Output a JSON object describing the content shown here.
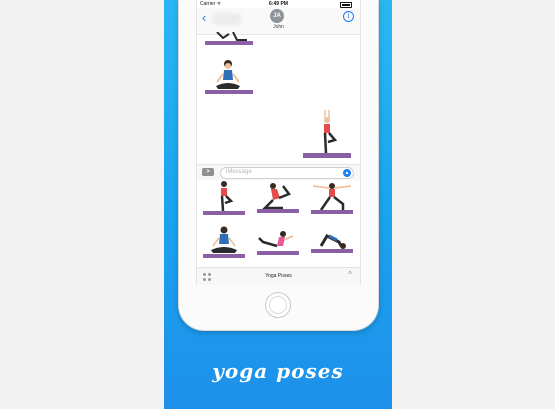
{
  "status_bar": {
    "carrier": "Carrier ᯤ",
    "time": "6:49 PM"
  },
  "nav": {
    "back": "‹",
    "avatar_initials": "JA",
    "contact_name": "John",
    "info_symbol": "i"
  },
  "compose": {
    "app_button": ">",
    "placeholder": "iMessage",
    "mic_symbol": "▲"
  },
  "tray": {
    "title": "Yoga Poses",
    "expand_symbol": "^"
  },
  "caption": "yoga poses",
  "colors": {
    "panel": "#1aa2ee",
    "mat": "#8a5fa6",
    "ios_blue": "#1d7df2",
    "skin": "#f0c09c",
    "hair": "#3b2a20"
  },
  "stickers": {
    "chat": [
      {
        "pose": "lunge",
        "label": ""
      },
      {
        "pose": "lotus-meditation",
        "label": ""
      },
      {
        "pose": "tree",
        "label": ""
      }
    ],
    "drawer": [
      {
        "pose": "tree",
        "label": ""
      },
      {
        "pose": "king-pigeon",
        "label": ""
      },
      {
        "pose": "warrior-ii",
        "label": ""
      },
      {
        "pose": "lotus-meditation",
        "label": ""
      },
      {
        "pose": "boat",
        "label": ""
      },
      {
        "pose": "bridge",
        "label": ""
      }
    ]
  }
}
